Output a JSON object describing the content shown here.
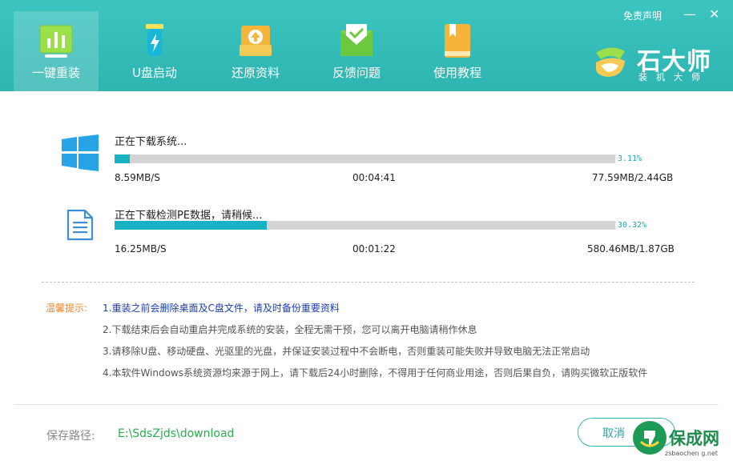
{
  "nav": {
    "items": [
      {
        "label": "一键重装",
        "icon": "chart-bars-icon",
        "active": true
      },
      {
        "label": "U盘启动",
        "icon": "usb-drive-icon",
        "active": false
      },
      {
        "label": "还原资料",
        "icon": "restore-box-icon",
        "active": false
      },
      {
        "label": "反馈问题",
        "icon": "envelope-icon",
        "active": false
      },
      {
        "label": "使用教程",
        "icon": "book-icon",
        "active": false
      }
    ]
  },
  "header": {
    "disclaimer": "免责声明",
    "minimize": "—",
    "close": "✕",
    "logo_text": "石大师",
    "logo_sub": "装机大师"
  },
  "downloads": [
    {
      "title": "正在下载系统...",
      "icon": "windows-logo-icon",
      "progress": 3.11,
      "percent_text": "3.11%",
      "speed": "8.59MB/S",
      "elapsed": "00:04:41",
      "size": "77.59MB/2.44GB"
    },
    {
      "title": "正在下载检测PE数据，请稍候...",
      "icon": "document-icon",
      "progress": 30.32,
      "percent_text": "30.32%",
      "speed": "16.25MB/S",
      "elapsed": "00:01:22",
      "size": "580.46MB/1.87GB"
    }
  ],
  "tips": {
    "label": "温馨提示:",
    "items": [
      "1.重装之前会删除桌面及C盘文件，请及时备份重要资料",
      "2.下载结束后会自动重启并完成系统的安装，全程无需干预，您可以离开电脑请稍作休息",
      "3.请移除U盘、移动硬盘、光驱里的光盘，并保证安装过程中不会断电，否则重装可能失败并导致电脑无法正常启动",
      "4.本软件Windows系统资源均来源于网上，请下载后24小时删除，不得用于任何商业用途，否则后果自负，请购买微软正版软件"
    ]
  },
  "footer": {
    "path_label": "保存路径:",
    "path_value": "E:\\SdsZjds\\download",
    "cancel_label": "取消"
  },
  "watermark": {
    "text": "保成网",
    "url": "zsbaochen g.net"
  },
  "colors": {
    "header": "#36bdb9",
    "progress": "#19b2c4",
    "tip_label": "#f0882d",
    "tip_first": "#1a3db4",
    "path": "#2bae4f"
  }
}
